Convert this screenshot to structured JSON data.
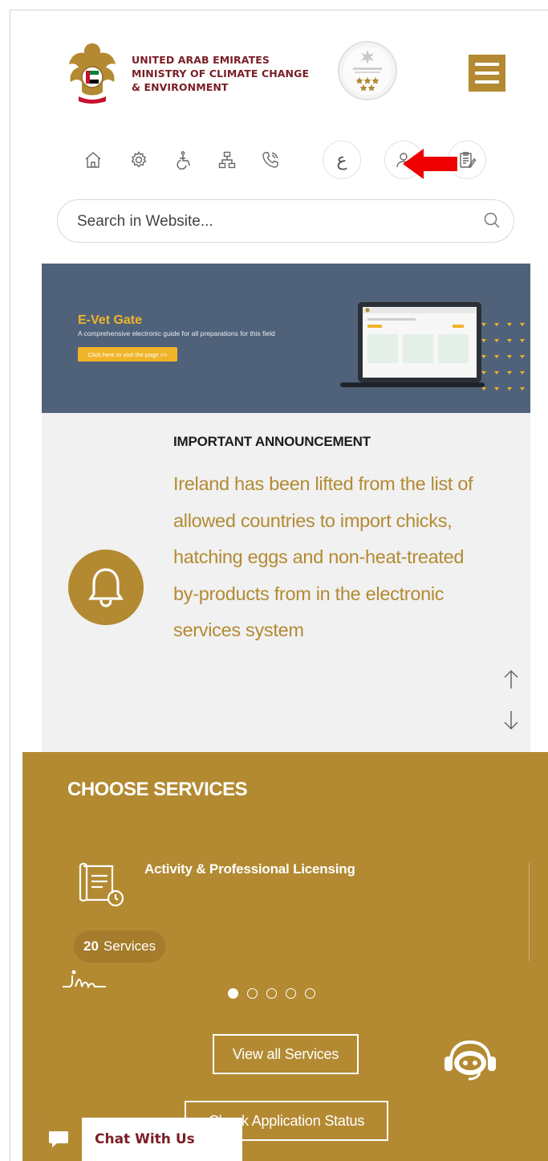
{
  "header": {
    "ministry_lines": [
      "UNITED ARAB EMIRATES",
      "MINISTRY OF CLIMATE CHANGE",
      "& ENVIRONMENT"
    ],
    "brand_color": "#b38a32",
    "text_color": "#7a1e26"
  },
  "toolbar": {
    "icons": [
      "home-icon",
      "settings-icon",
      "accessibility-icon",
      "sitemap-icon",
      "phone-icon",
      "arabic-language",
      "user-icon",
      "form-icon"
    ],
    "arabic_label": "ع"
  },
  "search": {
    "placeholder": "Search in Website..."
  },
  "banner": {
    "title": "E-Vet Gate",
    "subtitle": "A comprehensive electronic guide for all preparations for this field",
    "button_label": "Click here to visit the page >>",
    "background": "#50627a"
  },
  "announcement": {
    "heading": "IMPORTANT ANNOUNCEMENT",
    "body": "Ireland has been lifted from the list of allowed countries to import chicks, hatching eggs and non-heat-treated by-products from in the electronic services system"
  },
  "services": {
    "title": "CHOOSE SERVICES",
    "card_label": "Activity & Professional Licensing",
    "count_number": "20",
    "count_label": "Services",
    "pagination": {
      "total": 5,
      "active": 1
    },
    "view_all_label": "View all Services",
    "check_status_label": "Check Application Status"
  },
  "chat": {
    "label": "Chat With Us"
  }
}
